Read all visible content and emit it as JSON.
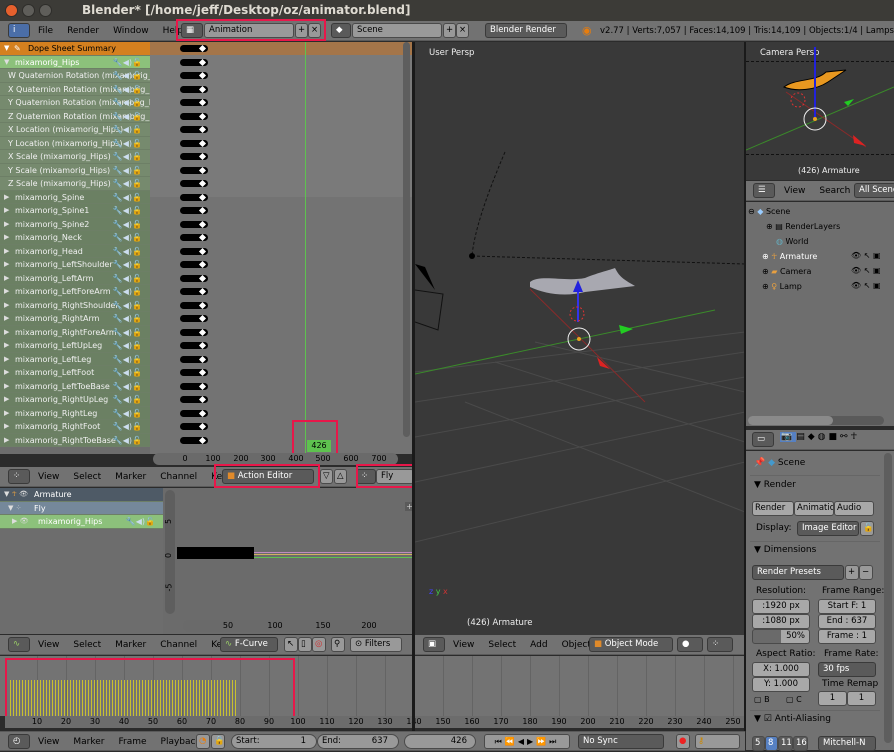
{
  "window": {
    "title": "Blender* [/home/jeff/Desktop/oz/animator.blend]"
  },
  "info_header": {
    "menus": [
      "File",
      "Render",
      "Window",
      "Help"
    ],
    "screen_layout": "Animation",
    "scene": "Scene",
    "render_engine": "Blender Render",
    "stats": "v2.77 | Verts:7,057 | Faces:14,109 | Tris:14,109 | Objects:1/4 | Lamps:0/1 | M"
  },
  "dope_sheet": {
    "summary_label": "Dope Sheet Summary",
    "group_label": "mixamorig_Hips",
    "sub_channels": [
      "W Quaternion Rotation (mixamorig_Hips)",
      "X Quaternion Rotation (mixamorig_Hips)",
      "Y Quaternion Rotation (mixamorig_Hips)",
      "Z Quaternion Rotation (mixamorig_Hips)",
      "X Location (mixamorig_Hips)",
      "Y Location (mixamorig_Hips)",
      "X Scale (mixamorig_Hips)",
      "Y Scale (mixamorig_Hips)",
      "Z Scale (mixamorig_Hips)"
    ],
    "bone_groups": [
      "mixamorig_Spine",
      "mixamorig_Spine1",
      "mixamorig_Spine2",
      "mixamorig_Neck",
      "mixamorig_Head",
      "mixamorig_LeftShoulder",
      "mixamorig_LeftArm",
      "mixamorig_LeftForeArm",
      "mixamorig_RightShoulder",
      "mixamorig_RightArm",
      "mixamorig_RightForeArm",
      "mixamorig_LeftUpLeg",
      "mixamorig_LeftLeg",
      "mixamorig_LeftFoot",
      "mixamorig_LeftToeBase",
      "mixamorig_RightUpLeg",
      "mixamorig_RightLeg",
      "mixamorig_RightFoot",
      "mixamorig_RightToeBase"
    ],
    "ruler_ticks": [
      "0",
      "100",
      "200",
      "300",
      "400",
      "500",
      "600",
      "700"
    ],
    "current_frame": "426",
    "header": {
      "menus": [
        "View",
        "Select",
        "Marker",
        "Channel",
        "Key"
      ],
      "mode": "Action Editor",
      "action": "Fly"
    }
  },
  "graph_editor": {
    "channels": {
      "object": "Armature",
      "action": "Fly",
      "group": "mixamorig_Hips"
    },
    "y_ticks": [
      "5",
      "0",
      "-5"
    ],
    "x_ticks": [
      "50",
      "100",
      "150",
      "200"
    ],
    "header": {
      "menus": [
        "View",
        "Select",
        "Marker",
        "Channel",
        "Key"
      ],
      "mode": "F-Curve",
      "filters_label": "Filters"
    }
  },
  "timeline_strip": {
    "ticks": [
      "10",
      "20",
      "30",
      "40",
      "50",
      "60",
      "70",
      "80",
      "90",
      "100",
      "110",
      "120",
      "130",
      "140",
      "150",
      "160",
      "170",
      "180",
      "190",
      "200",
      "210",
      "220",
      "230",
      "240",
      "250"
    ]
  },
  "timeline_header": {
    "menus": [
      "View",
      "Marker",
      "Frame",
      "Playback"
    ],
    "start_label": "Start:",
    "start_value": "1",
    "end_label": "End:",
    "end_value": "637",
    "current_frame": "426",
    "sync": "No Sync"
  },
  "viewport": {
    "view_label": "User Persp",
    "object_label": "(426) Armature",
    "header": {
      "menus": [
        "View",
        "Select",
        "Add",
        "Object"
      ],
      "mode": "Object Mode"
    }
  },
  "camera_view": {
    "view_label": "Camera Persp",
    "object_label": "(426) Armature"
  },
  "outliner": {
    "menus": [
      "View",
      "Search"
    ],
    "filter": "All Scenes",
    "items": [
      "Scene",
      "RenderLayers",
      "World",
      "Armature",
      "Camera",
      "Lamp"
    ]
  },
  "properties": {
    "context": "Scene",
    "render_panel": {
      "title": "Render",
      "buttons": [
        "Render",
        "Animation",
        "Audio"
      ],
      "display_label": "Display:",
      "display_value": "Image Editor"
    },
    "dimensions_panel": {
      "title": "Dimensions",
      "presets": "Render Presets",
      "resolution_label": "Resolution:",
      "res_x": ":1920 px",
      "res_y": ":1080 px",
      "res_percent": "50%",
      "frame_range_label": "Frame Range:",
      "start": "Start F: 1",
      "end": "End : 637",
      "frame": "Frame : 1",
      "aspect_label": "Aspect Ratio:",
      "aspect_x": "X:  1.000",
      "aspect_y": "Y:  1.000",
      "border_b": "B",
      "crop_c": "C",
      "frame_rate_label": "Frame Rate:",
      "frame_rate": "30 fps",
      "time_remap_label": "Time Remap",
      "remap_old": "1",
      "remap_new": "1"
    },
    "aa_panel": {
      "title": "Anti-Aliasing",
      "samples": [
        "5",
        "8",
        "11",
        "16"
      ],
      "selected": "8",
      "filter": "Mitchell-N"
    }
  }
}
